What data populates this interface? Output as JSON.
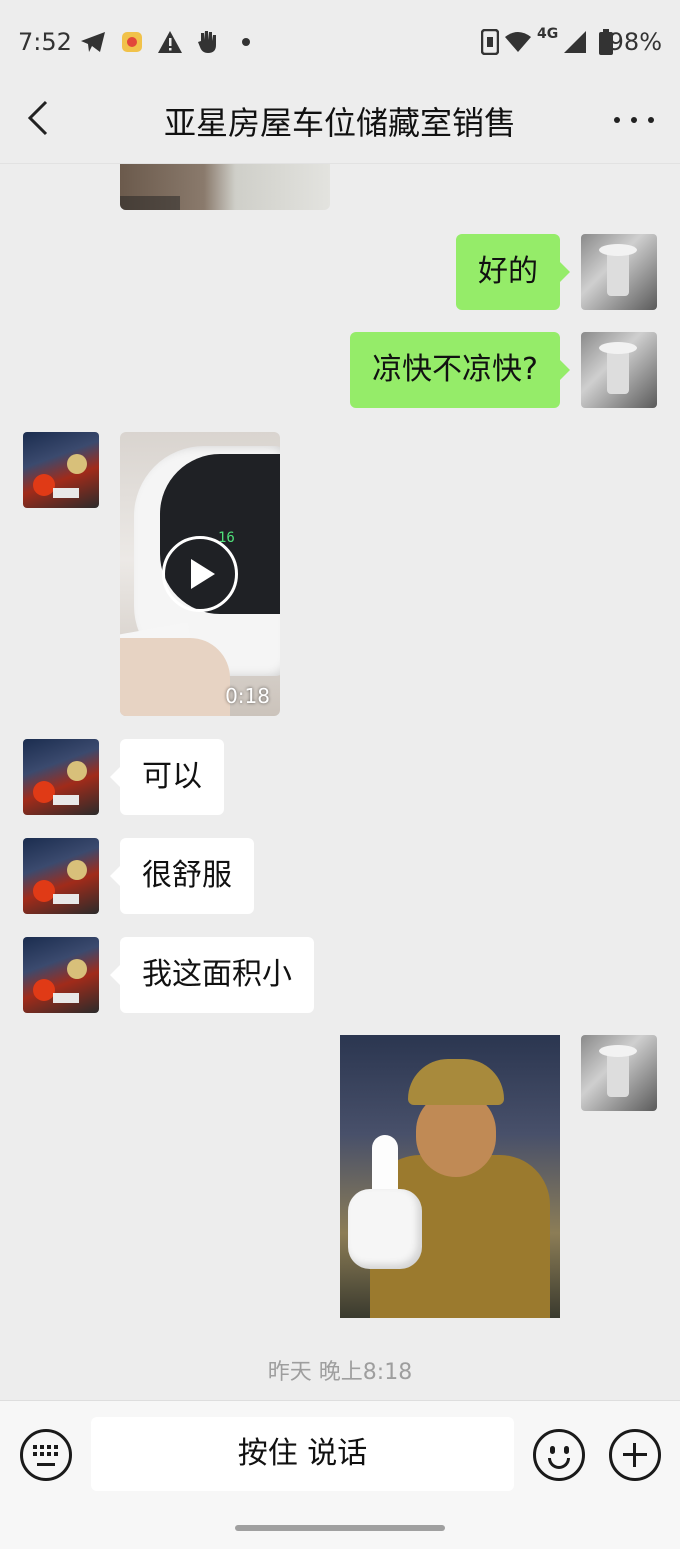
{
  "status_bar": {
    "time": "7:52",
    "network": "4G",
    "battery": "98%",
    "icons": [
      "telegram-icon",
      "app-notification-icon",
      "warning-icon",
      "hand-icon",
      "dot-icon",
      "nfc-icon",
      "wifi-icon",
      "signal-icon",
      "battery-icon"
    ]
  },
  "header": {
    "title": "亚星房屋车位储藏室销售",
    "back_icon": "chevron-left-icon",
    "more_icon": "more-dots-icon"
  },
  "messages": [
    {
      "sender": "other",
      "type": "image"
    },
    {
      "sender": "me",
      "type": "text",
      "text": "好的"
    },
    {
      "sender": "me",
      "type": "text",
      "text": "凉快不凉快?"
    },
    {
      "sender": "other",
      "type": "video",
      "duration": "0:18"
    },
    {
      "sender": "other",
      "type": "text",
      "text": "可以"
    },
    {
      "sender": "other",
      "type": "text",
      "text": "很舒服"
    },
    {
      "sender": "other",
      "type": "text",
      "text": "我这面积小"
    },
    {
      "sender": "me",
      "type": "sticker"
    }
  ],
  "timestamp": "昨天 晚上8:18",
  "input_bar": {
    "hold_to_talk": "按住 说话",
    "icons": [
      "keyboard-icon",
      "emoji-icon",
      "plus-icon"
    ]
  },
  "colors": {
    "my_bubble": "#95ec69",
    "their_bubble": "#ffffff",
    "background": "#ededed"
  }
}
